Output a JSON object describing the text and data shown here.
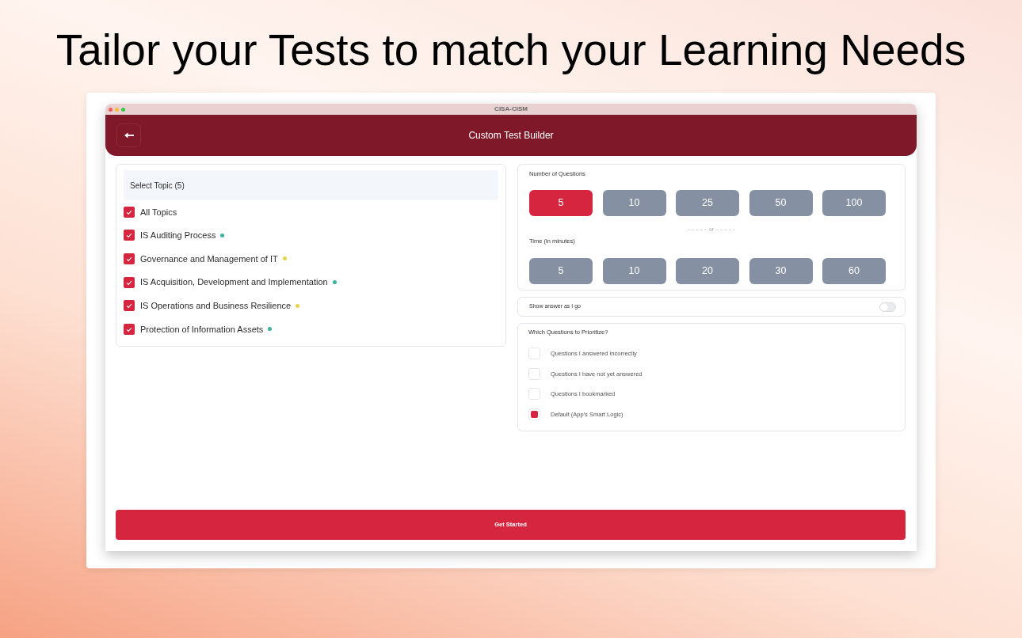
{
  "headline": "Tailor your Tests to match your Learning Needs",
  "window": {
    "title": "CISA-CISM"
  },
  "header": {
    "title": "Custom Test Builder"
  },
  "topics": {
    "title": "Select Topic (5)",
    "items": [
      {
        "label": "All Topics",
        "checked": true
      },
      {
        "label": "IS Auditing Process",
        "checked": true,
        "color": "#3bb3a0"
      },
      {
        "label": "Governance and Management of IT",
        "checked": true,
        "color": "#e8d24a"
      },
      {
        "label": "IS Acquisition, Development and Implementation",
        "checked": true,
        "color": "#3bb3a0"
      },
      {
        "label": "IS Operations and Business Resilience",
        "checked": true,
        "color": "#e8d24a"
      },
      {
        "label": "Protection of Information Assets",
        "checked": true,
        "color": "#3bb3a0"
      }
    ]
  },
  "question_count": {
    "label": "Number of Questions",
    "options": [
      {
        "label": "5",
        "selected": true
      },
      {
        "label": "10",
        "selected": false
      },
      {
        "label": "25",
        "selected": false
      },
      {
        "label": "50",
        "selected": false
      },
      {
        "label": "100",
        "selected": false
      }
    ]
  },
  "divider": "or",
  "time": {
    "label": "Time (in minutes)",
    "options": [
      {
        "label": "5",
        "selected": false
      },
      {
        "label": "10",
        "selected": false
      },
      {
        "label": "20",
        "selected": false
      },
      {
        "label": "30",
        "selected": false
      },
      {
        "label": "60",
        "selected": false
      }
    ]
  },
  "show_answer": {
    "label": "Show answer as I go",
    "on": false
  },
  "priority": {
    "title": "Which Questions to Prioritize?",
    "options": [
      {
        "label": "Questions I answered incorrectly",
        "checked": false
      },
      {
        "label": "Questions I have not yet answered",
        "checked": false
      },
      {
        "label": "Questions I bookmarked",
        "checked": false
      },
      {
        "label": "Default (App's Smart Logic)",
        "checked": true
      }
    ]
  },
  "start_button": "Get Started"
}
